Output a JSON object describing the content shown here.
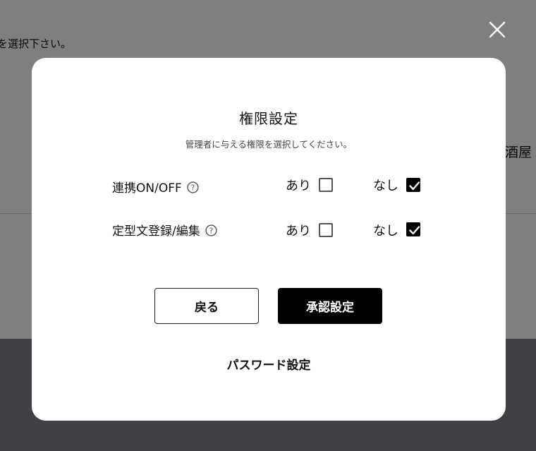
{
  "background": {
    "top_text": "を選択下さい。",
    "right_text": "酒屋"
  },
  "modal": {
    "title": "権限設定",
    "subtitle": "管理者に与える権限を選択してください。",
    "permissions": [
      {
        "label": "連携ON/OFF",
        "yes_label": "あり",
        "no_label": "なし",
        "yes_checked": false,
        "no_checked": true
      },
      {
        "label": "定型文登録/編集",
        "yes_label": "あり",
        "no_label": "なし",
        "yes_checked": false,
        "no_checked": true
      }
    ],
    "back_button": "戻る",
    "approve_button": "承認設定",
    "password_link": "パスワード設定"
  },
  "icons": {
    "close": "close-icon",
    "help": "help-circle-icon",
    "check": "checkmark-icon"
  },
  "colors": {
    "overlay": "#7f7e8a",
    "primary_button": "#000000",
    "checkbox_checked": "#000000"
  }
}
